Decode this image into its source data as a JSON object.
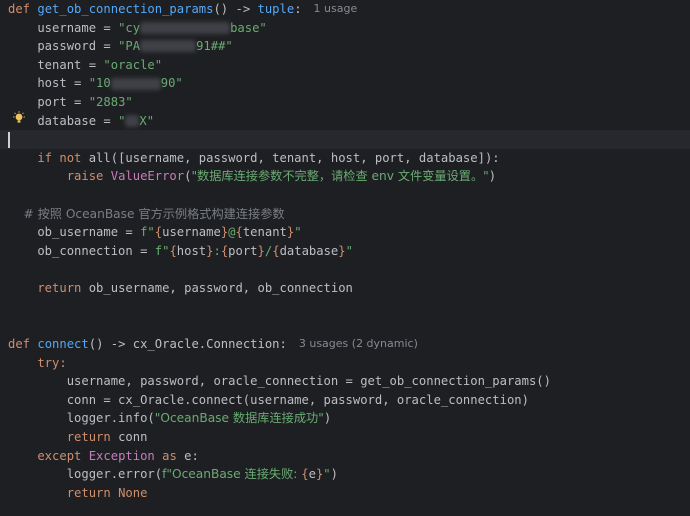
{
  "code": {
    "fn1_def_kw": "def",
    "fn1_name": "get_ob_connection_params",
    "fn1_sig": "() -> ",
    "fn1_ret": "tuple",
    "fn1_colon": ":",
    "fn1_usage": "1 usage",
    "l_username_lhs": "    username = ",
    "l_username_a": "\"cy",
    "l_username_b": "base\"",
    "l_password_lhs": "    password = ",
    "l_password_a": "\"PA",
    "l_password_b": "91##\"",
    "l_tenant_lhs": "    tenant = ",
    "l_tenant_val": "\"oracle\"",
    "l_host_lhs": "    host = ",
    "l_host_a": "\"10",
    "l_host_b": "90\"",
    "l_port_lhs": "    port = ",
    "l_port_val": "\"2883\"",
    "l_db_lhs": "    database = ",
    "l_db_a": "\"",
    "l_db_b": "X\"",
    "if_kw": "    if not ",
    "if_all": "all",
    "if_rest": "([username, password, tenant, host, port, database]):",
    "raise_kw": "        raise ",
    "raise_cls": "ValueError",
    "raise_open": "(",
    "raise_msg": "\"数据库连接参数不完整，请检查 env 文件变量设置。\"",
    "raise_close": ")",
    "comment": "    # 按照 OceanBase 官方示例格式构建连接参数",
    "obu_lhs": "    ob_username = ",
    "obu_f": "f\"",
    "obu_b1": "{",
    "obu_v1": "username",
    "obu_b2": "}",
    "obu_at": "@",
    "obu_b3": "{",
    "obu_v2": "tenant",
    "obu_b4": "}",
    "obu_end": "\"",
    "obc_lhs": "    ob_connection = ",
    "obc_f": "f\"",
    "obc_b1": "{",
    "obc_v1": "host",
    "obc_b2": "}",
    "obc_colon": ":",
    "obc_b3": "{",
    "obc_v2": "port",
    "obc_b4": "}",
    "obc_slash": "/",
    "obc_b5": "{",
    "obc_v3": "database",
    "obc_b6": "}",
    "obc_end": "\"",
    "return1_kw": "    return ",
    "return1_rest": "ob_username, password, ob_connection",
    "fn2_def_kw": "def",
    "fn2_name": "connect",
    "fn2_sig": "() -> cx_Oracle.Connection:",
    "fn2_usage": "3 usages (2 dynamic)",
    "try_kw": "    try:",
    "t1": "        username, password, oracle_connection = get_ob_connection_params()",
    "t2": "        conn = cx_Oracle.connect(username, password, oracle_connection)",
    "t3_a": "        logger.info(",
    "t3_str": "\"OceanBase 数据库连接成功\"",
    "t3_b": ")",
    "t4_kw": "        return ",
    "t4_rest": "conn",
    "exc_kw1": "    except ",
    "exc_cls": "Exception",
    "exc_kw2": " as ",
    "exc_rest": "e:",
    "e1_a": "        logger.error(",
    "e1_f": "f\"OceanBase 连接失败: ",
    "e1_b1": "{",
    "e1_v": "e",
    "e1_b2": "}",
    "e1_end": "\"",
    "e1_close": ")",
    "e2_kw": "        return ",
    "e2_none": "None"
  },
  "icons": {
    "bulb": "lightbulb-icon"
  },
  "colors": {
    "background": "#1e1f22",
    "keyword": "#cf8e6d",
    "function": "#56a8f5",
    "string": "#6aab73",
    "comment": "#7a7e85",
    "hint": "#868a91",
    "bulb": "#f2c55c"
  }
}
